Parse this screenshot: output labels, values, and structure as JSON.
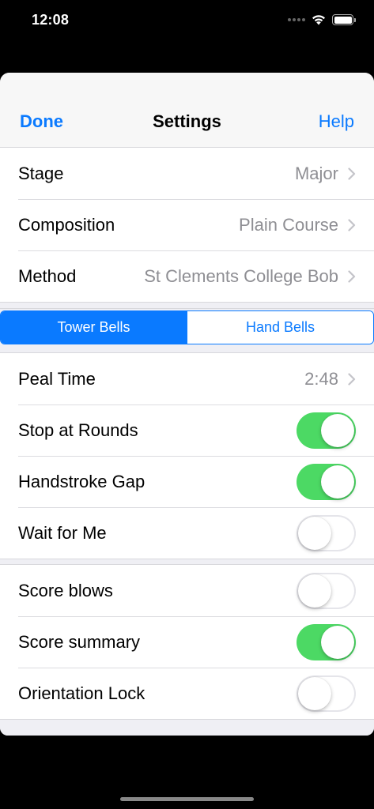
{
  "status_bar": {
    "time": "12:08"
  },
  "nav": {
    "left": "Done",
    "title": "Settings",
    "right": "Help"
  },
  "group1": {
    "stage": {
      "label": "Stage",
      "value": "Major"
    },
    "composition": {
      "label": "Composition",
      "value": "Plain Course"
    },
    "method": {
      "label": "Method",
      "value": "St Clements College Bob"
    }
  },
  "segmented": {
    "option1": "Tower Bells",
    "option2": "Hand Bells",
    "selected": "Tower Bells"
  },
  "group2": {
    "peal_time": {
      "label": "Peal Time",
      "value": "2:48"
    },
    "stop_at_rounds": {
      "label": "Stop at Rounds",
      "on": true
    },
    "handstroke_gap": {
      "label": "Handstroke Gap",
      "on": true
    },
    "wait_for_me": {
      "label": "Wait for Me",
      "on": false
    }
  },
  "group3": {
    "score_blows": {
      "label": "Score blows",
      "on": false
    },
    "score_summary": {
      "label": "Score summary",
      "on": true
    },
    "orientation_lock": {
      "label": "Orientation Lock",
      "on": false
    }
  },
  "colors": {
    "accent": "#0a7aff",
    "toggle_on": "#4cd964",
    "secondary_text": "#8e8e93",
    "background": "#efeff4"
  },
  "icons": [
    "wifi-icon",
    "battery-icon",
    "chevron-right-icon"
  ]
}
